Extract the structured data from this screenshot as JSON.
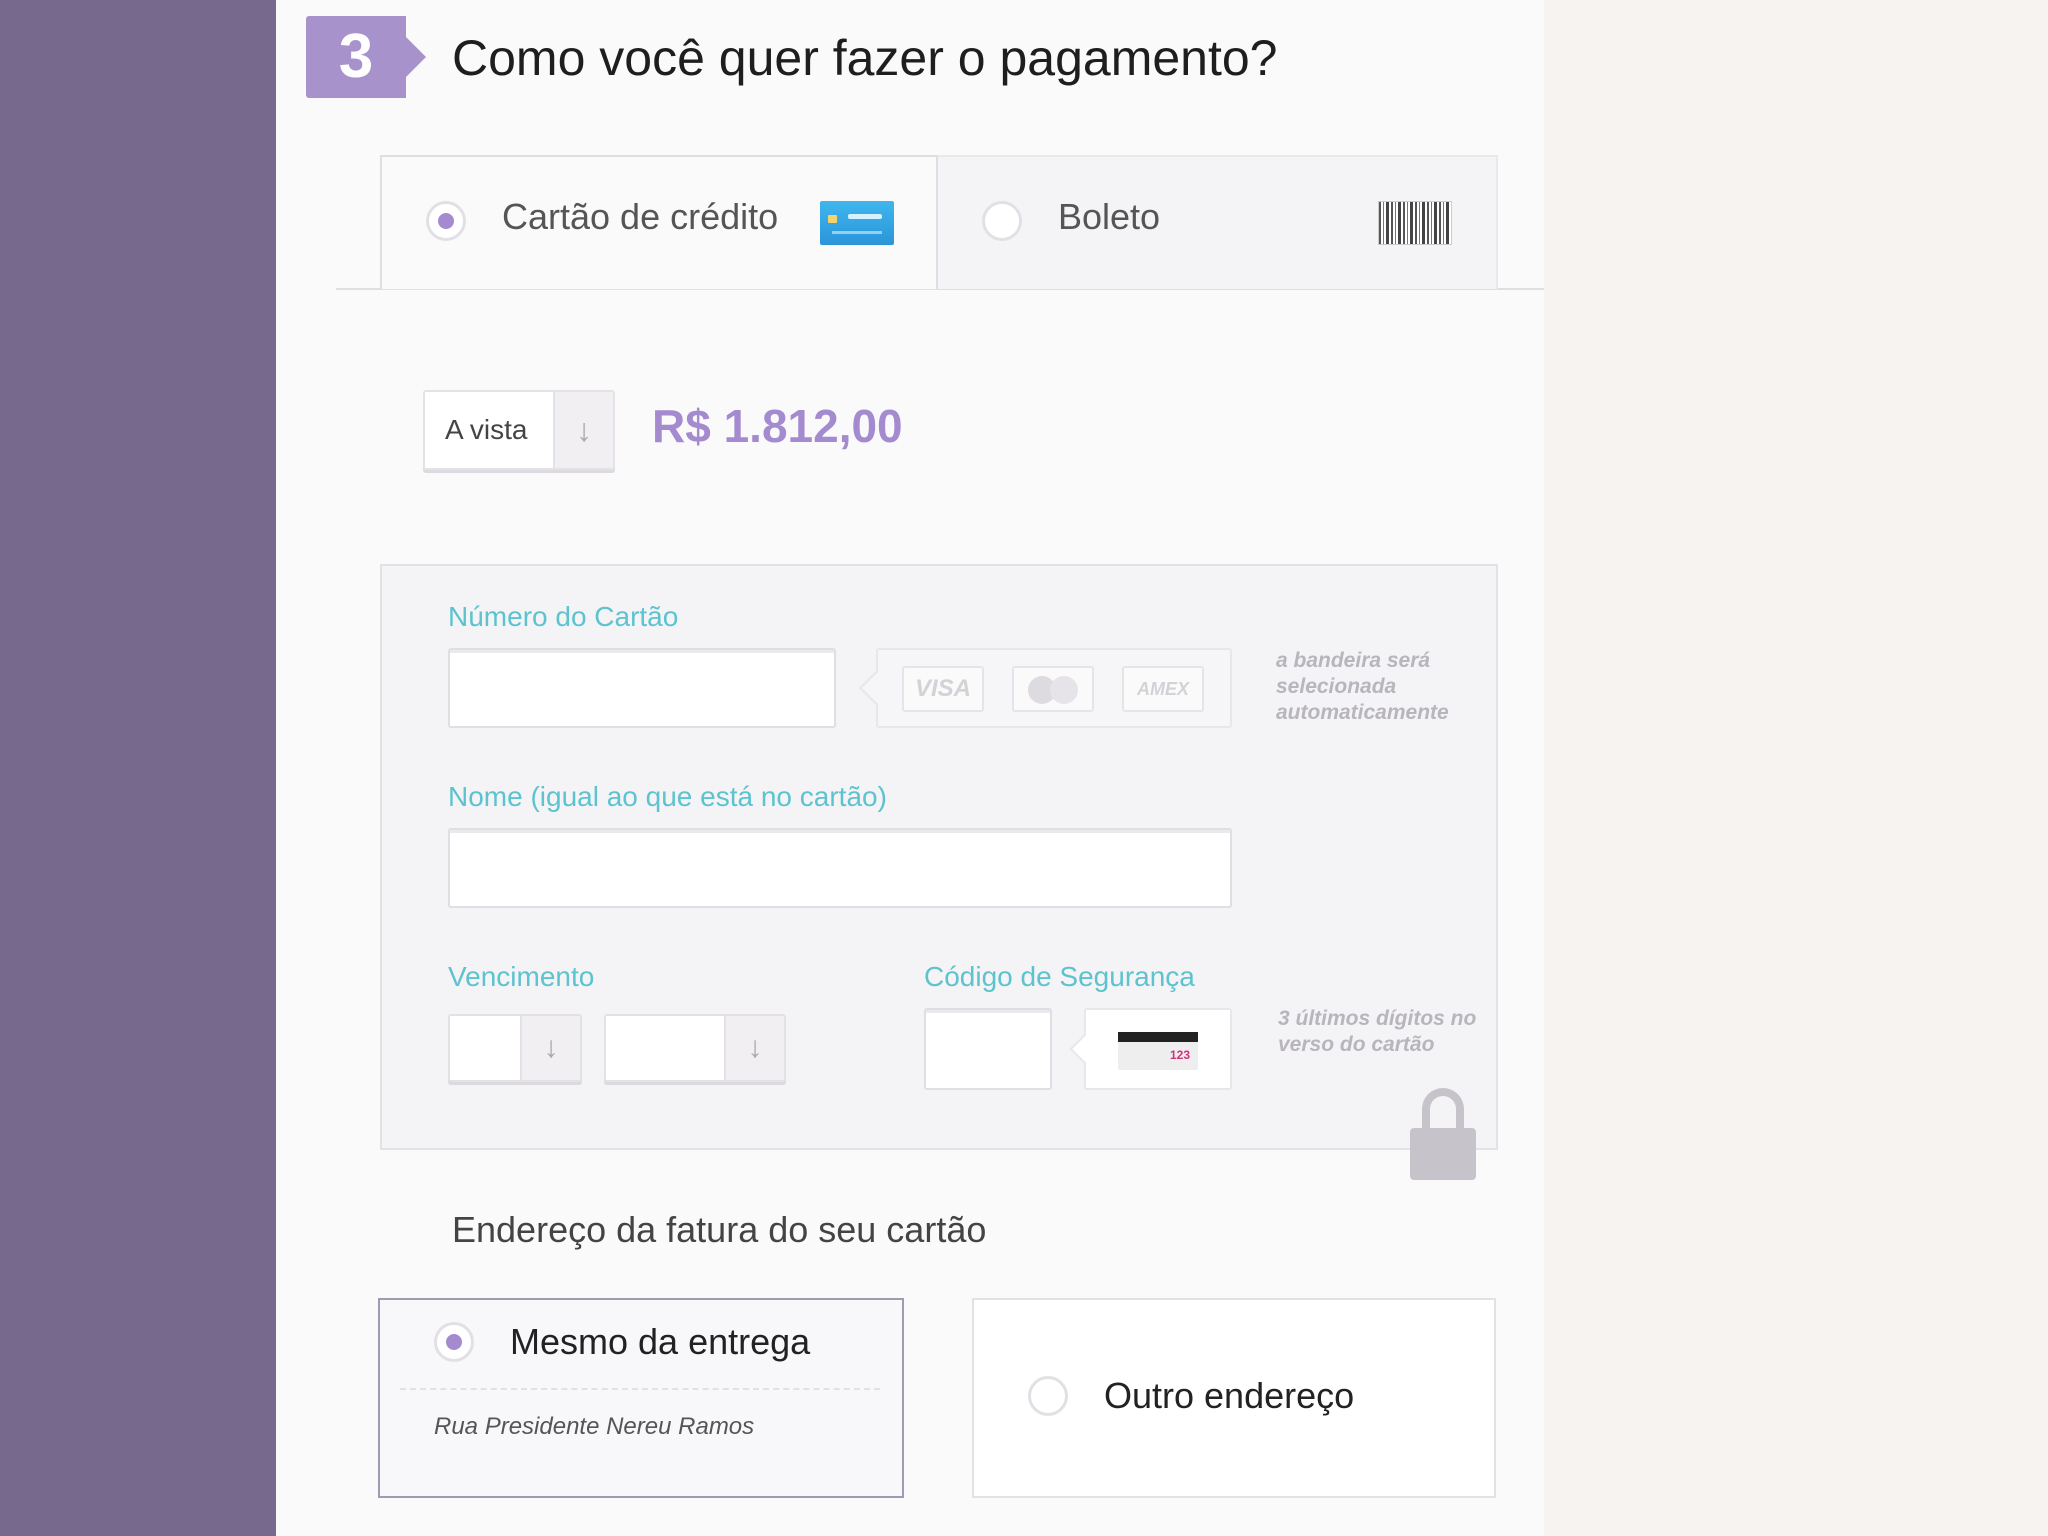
{
  "step": {
    "number": "3",
    "title": "Como você quer fazer o pagamento?"
  },
  "payment_tabs": {
    "credit_card": {
      "label": "Cartão de crédito",
      "selected": true,
      "icon": "credit-card-icon"
    },
    "boleto": {
      "label": "Boleto",
      "selected": false,
      "icon": "barcode-icon"
    }
  },
  "installments": {
    "selected": "A vista",
    "arrow": "↓",
    "price": "R$ 1.812,00"
  },
  "card_form": {
    "number_label": "Número do Cartão",
    "number_value": "",
    "brands": [
      "VISA",
      "MasterCard",
      "AMEX"
    ],
    "brand_hint": "a bandeira será selecionada automaticamente",
    "name_label": "Nome (igual ao que está no cartão)",
    "name_value": "",
    "expiry_label": "Vencimento",
    "expiry_month": "",
    "expiry_year": "",
    "expiry_arrow": "↓",
    "security_label": "Código de Segurança",
    "security_value": "",
    "security_sample": "123",
    "security_hint": "3 últimos dígitos no verso do cartão"
  },
  "billing": {
    "title": "Endereço da fatura do seu cartão",
    "same": {
      "label": "Mesmo da entrega",
      "selected": true,
      "street": "Rua Presidente Nereu Ramos"
    },
    "other": {
      "label": "Outro endereço",
      "selected": false
    }
  },
  "colors": {
    "sidebar": "#77698d",
    "accent": "#a48bd0",
    "label": "#5cc3cf",
    "panel": "#fbfafb"
  }
}
